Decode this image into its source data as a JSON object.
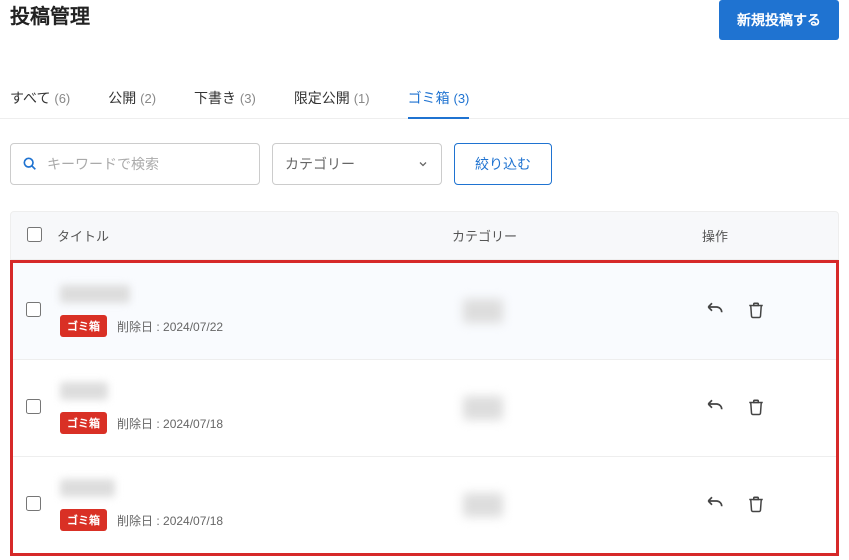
{
  "header": {
    "title": "投稿管理",
    "new_post_btn": "新規投稿する"
  },
  "tabs": [
    {
      "label": "すべて",
      "count": "(6)",
      "active": false
    },
    {
      "label": "公開",
      "count": "(2)",
      "active": false
    },
    {
      "label": "下書き",
      "count": "(3)",
      "active": false
    },
    {
      "label": "限定公開",
      "count": "(1)",
      "active": false
    },
    {
      "label": "ゴミ箱",
      "count": "(3)",
      "active": true
    }
  ],
  "filters": {
    "search_placeholder": "キーワードで検索",
    "category_label": "カテゴリー",
    "filter_btn": "絞り込む"
  },
  "table": {
    "headers": {
      "title": "タイトル",
      "category": "カテゴリー",
      "actions": "操作"
    },
    "deleted_prefix": "削除日 : ",
    "trash_badge": "ゴミ箱",
    "rows": [
      {
        "deleted_date": "2024/07/22"
      },
      {
        "deleted_date": "2024/07/18"
      },
      {
        "deleted_date": "2024/07/18"
      }
    ]
  }
}
